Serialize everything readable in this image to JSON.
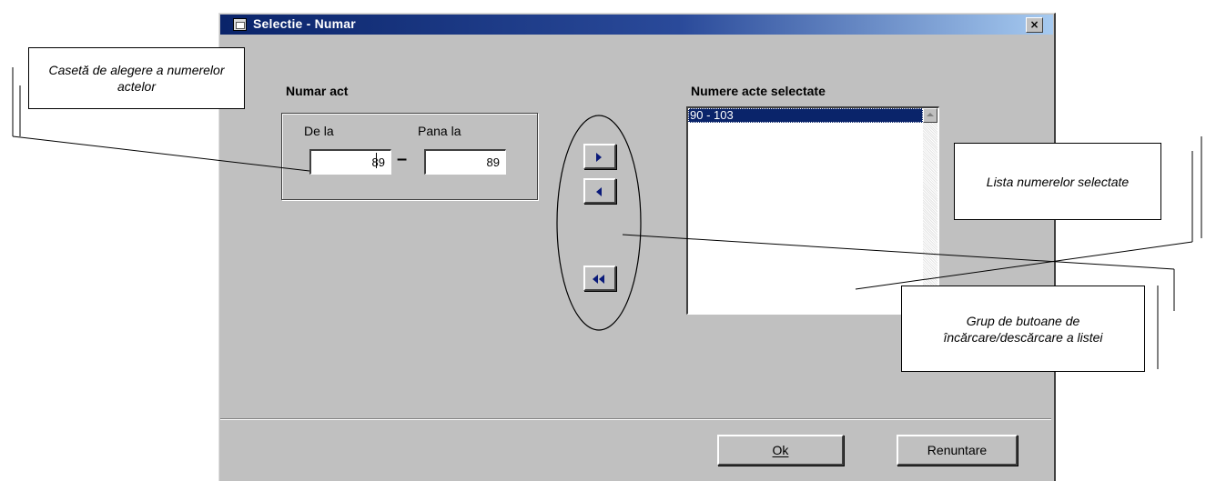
{
  "dialog": {
    "title": "Selectie - Numar",
    "close_label": "×",
    "numar_act_label": "Numar act",
    "de_la_label": "De la",
    "pana_la_label": "Pana la",
    "de_la_value": "89",
    "pana_la_value": "89",
    "dash": "–",
    "selected_label": "Numere acte selectate",
    "selected_items": [
      "90 - 103"
    ],
    "ok_label": "Ok",
    "cancel_label": "Renuntare"
  },
  "annotations": {
    "callout_left": "Casetă de alegere a numerelor actelor",
    "callout_right": "Lista numerelor selectate",
    "callout_bottom": "Grup de butoane de încărcare/descărcare a listei"
  },
  "colors": {
    "titlebar": "#0a246a",
    "dialog_bg": "#c0c0c0",
    "selection": "#0a246a",
    "arrow": "#0a1a7a"
  }
}
